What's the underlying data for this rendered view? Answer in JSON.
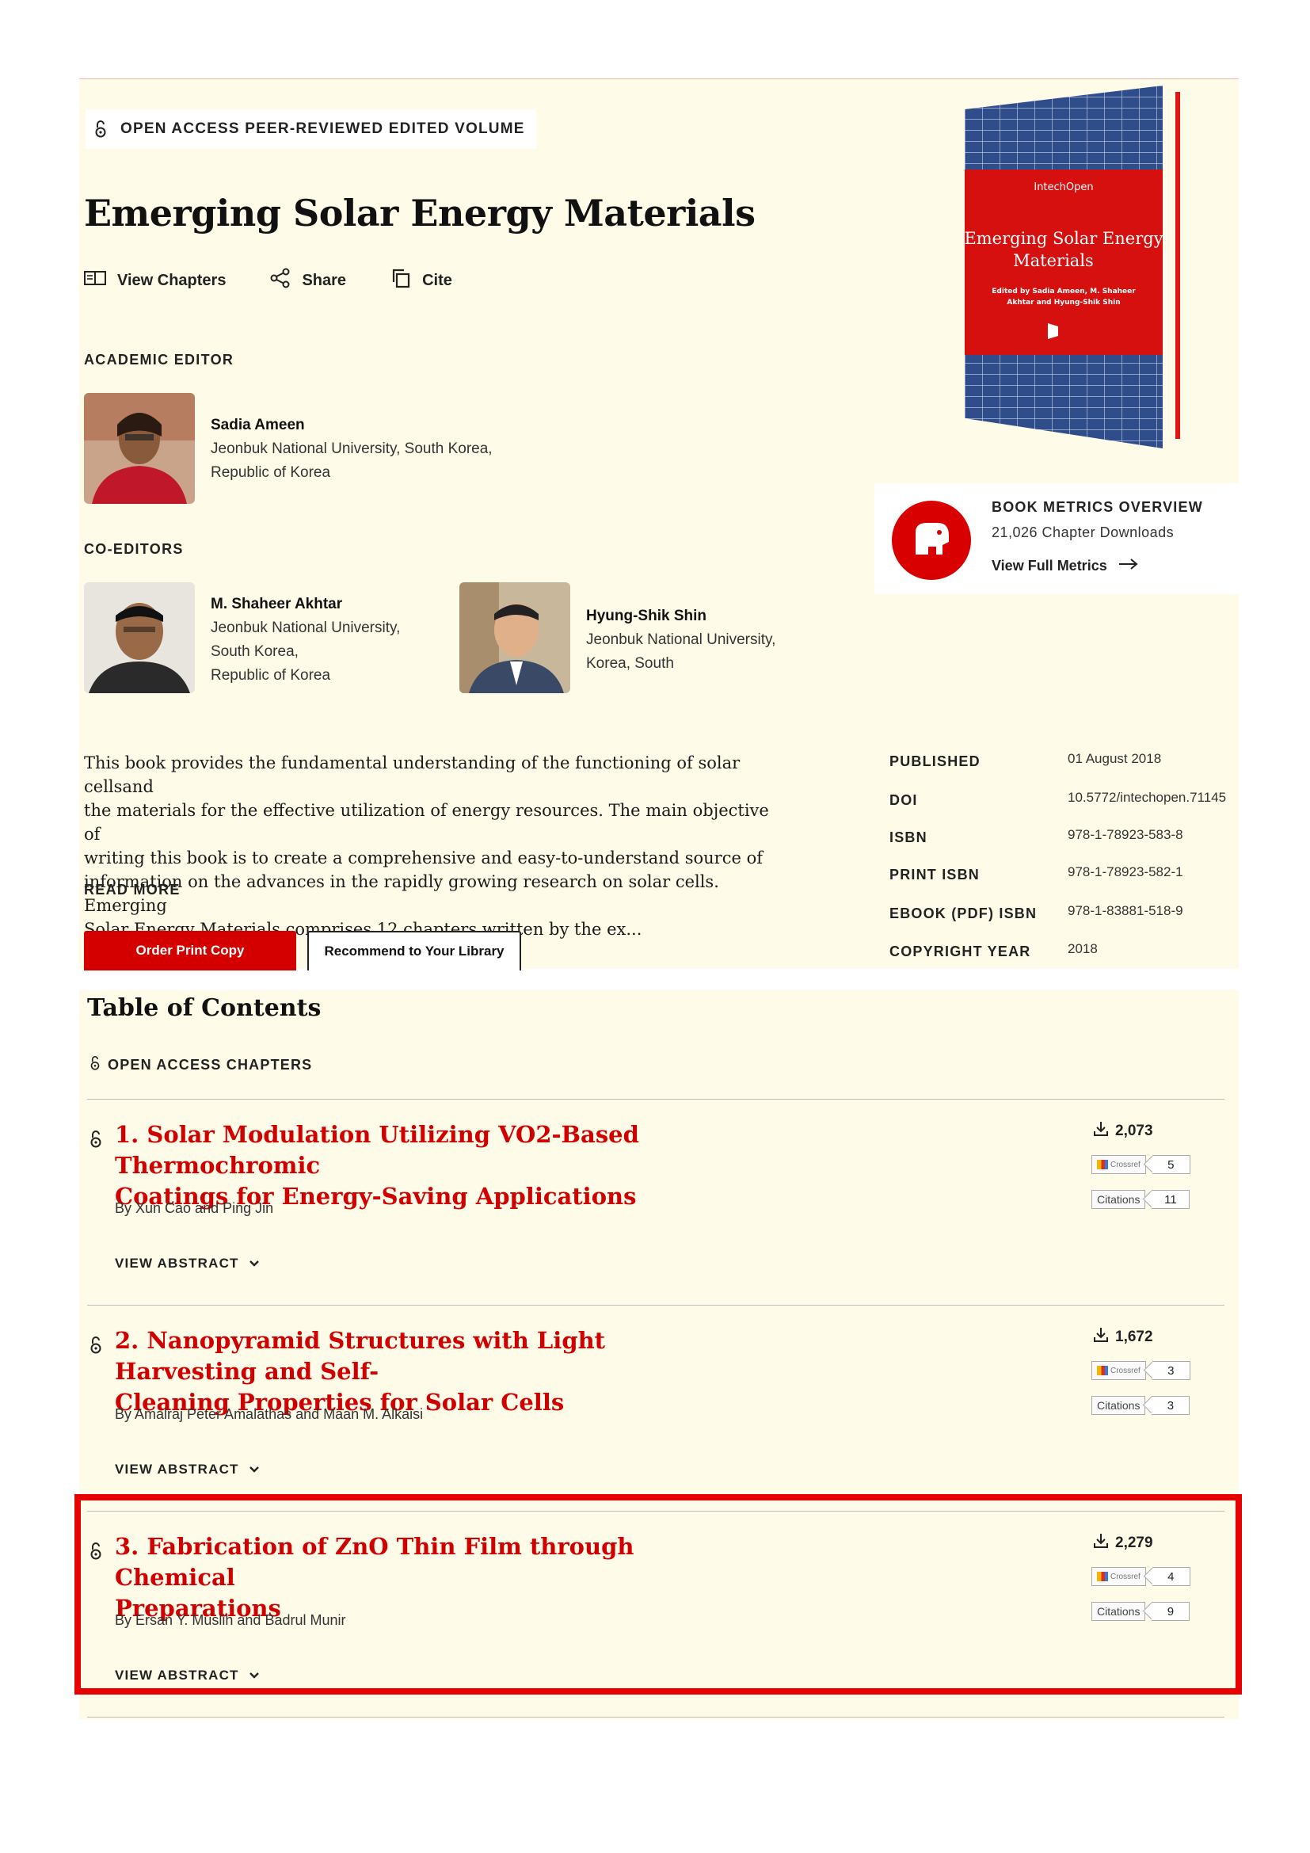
{
  "header": {
    "badge": "OPEN ACCESS PEER-REVIEWED EDITED VOLUME",
    "title": "Emerging Solar Energy Materials",
    "actions": [
      "View Chapters",
      "Share",
      "Cite"
    ]
  },
  "academic_editor": {
    "label": "ACADEMIC EDITOR",
    "name": "Sadia Ameen",
    "affiliation_1": "Jeonbuk National University, South Korea,",
    "affiliation_2": "Republic of Korea"
  },
  "co_editors": {
    "label": "CO-EDITORS",
    "people": [
      {
        "name": "M. Shaheer Akhtar",
        "lines": [
          "Jeonbuk National University,",
          "South Korea,",
          "Republic of Korea"
        ]
      },
      {
        "name": "Hyung-Shik Shin",
        "lines": [
          "Jeonbuk National University,",
          "Korea, South"
        ]
      }
    ]
  },
  "cover": {
    "publisher": "IntechOpen",
    "title_1": "Emerging Solar Energy",
    "title_2": "Materials",
    "edited_1": "Edited by Sadia Ameen, M. Shaheer",
    "edited_2": "Akhtar and Hyung-Shik Shin"
  },
  "metrics": {
    "title": "BOOK METRICS OVERVIEW",
    "downloads": "21,026 Chapter Downloads",
    "link": "View Full Metrics"
  },
  "description": {
    "lines": [
      "This book provides the fundamental understanding of the functioning of solar cellsand",
      "the materials for the effective utilization of energy resources. The main objective of",
      "writing this book is to create a comprehensive and easy-to-understand source of",
      "information on the advances in the rapidly growing research on solar cells. Emerging",
      "Solar Energy Materials comprises 12 chapters written by the ex..."
    ],
    "read_more": "READ MORE"
  },
  "buttons": {
    "order": "Order Print Copy",
    "recommend": "Recommend to Your Library"
  },
  "book_meta": [
    {
      "label": "PUBLISHED",
      "value": "01 August 2018"
    },
    {
      "label": "DOI",
      "value": "10.5772/intechopen.71145"
    },
    {
      "label": "ISBN",
      "value": "978-1-78923-583-8"
    },
    {
      "label": "PRINT ISBN",
      "value": "978-1-78923-582-1"
    },
    {
      "label": "EBOOK (PDF) ISBN",
      "value": "978-1-83881-518-9"
    },
    {
      "label": "COPYRIGHT YEAR",
      "value": "2018"
    }
  ],
  "toc": {
    "title": "Table of Contents",
    "subtitle": "OPEN ACCESS CHAPTERS",
    "view_abstract": "VIEW ABSTRACT",
    "crossref_label": "Crossref",
    "citations_label": "Citations",
    "chapters": [
      {
        "title_1": "1. Solar Modulation Utilizing VO2-Based Thermochromic",
        "title_2": "Coatings for Energy-Saving Applications",
        "authors": "By Xun Cao and Ping Jin",
        "downloads": "2,073",
        "crossref": "5",
        "citations": "11"
      },
      {
        "title_1": "2. Nanopyramid Structures with Light Harvesting and Self-",
        "title_2": "Cleaning Properties for Solar Cells",
        "authors": "By Amalraj Peter Amalathas and Maan M. Alkaisi",
        "downloads": "1,672",
        "crossref": "3",
        "citations": "3"
      },
      {
        "title_1": "3. Fabrication of ZnO Thin Film through Chemical",
        "title_2": "Preparations",
        "authors": "By Ersan Y. Muslih and Badrul Munir",
        "downloads": "2,279",
        "crossref": "4",
        "citations": "9"
      }
    ]
  },
  "colors": {
    "accent": "#d10000",
    "page_bg": "#fefbe8",
    "highlight": "#e80000"
  }
}
